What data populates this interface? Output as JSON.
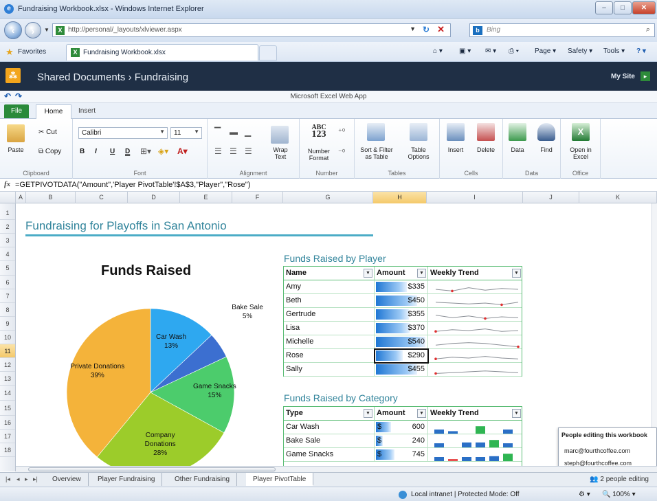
{
  "window": {
    "title": "Fundraising Workbook.xlsx - Windows Internet Explorer"
  },
  "browser": {
    "url": "http://personal/_layouts/xlviewer.aspx",
    "search_placeholder": "Bing",
    "favorites_label": "Favorites",
    "tab_title": "Fundraising Workbook.xlsx",
    "commands": [
      "Page ▾",
      "Safety ▾",
      "Tools ▾"
    ]
  },
  "sharepoint": {
    "breadcrumb": "Shared Documents › Fundraising",
    "my_site": "My Site"
  },
  "excel": {
    "app_title": "Microsoft Excel Web App",
    "tabs": {
      "file": "File",
      "home": "Home",
      "insert": "Insert"
    },
    "ribbon": {
      "clipboard": {
        "label": "Clipboard",
        "paste": "Paste",
        "cut": "Cut",
        "copy": "Copy"
      },
      "font": {
        "label": "Font",
        "name": "Calibri",
        "size": "11",
        "bold": "B",
        "italic": "I",
        "underline": "U",
        "dunder": "D"
      },
      "alignment": {
        "label": "Alignment",
        "wrap": "Wrap Text"
      },
      "number": {
        "label": "Number",
        "format": "Number Format",
        "abc": "ABC",
        "n123": "123"
      },
      "tables": {
        "label": "Tables",
        "sort": "Sort & Filter as Table",
        "options": "Table Options"
      },
      "cells": {
        "label": "Cells",
        "insert": "Insert",
        "delete": "Delete"
      },
      "data": {
        "label": "Data",
        "data": "Data",
        "find": "Find"
      },
      "office": {
        "label": "Office",
        "open": "Open in Excel"
      }
    },
    "formula": "=GETPIVOTDATA(\"Amount\",'Player PivotTable'!$A$3,\"Player\",\"Rose\")",
    "columns": [
      "A",
      "B",
      "C",
      "D",
      "E",
      "F",
      "G",
      "H",
      "I",
      "J",
      "K"
    ],
    "selected_column": "H",
    "rows": [
      "1",
      "2",
      "3",
      "4",
      "5",
      "6",
      "7",
      "8",
      "9",
      "10",
      "11",
      "12",
      "13",
      "14",
      "15",
      "16",
      "17",
      "18"
    ],
    "selected_row": "11"
  },
  "sheet": {
    "heading": "Fundraising for Playoffs in San Antonio",
    "player_table": {
      "title": "Funds Raised by Player",
      "headers": [
        "Name",
        "Amount",
        "Weekly Trend"
      ],
      "rows": [
        {
          "name": "Amy",
          "amount": "$335",
          "pct": 0.62
        },
        {
          "name": "Beth",
          "amount": "$450",
          "pct": 0.83
        },
        {
          "name": "Gertrude",
          "amount": "$355",
          "pct": 0.66
        },
        {
          "name": "Lisa",
          "amount": "$370",
          "pct": 0.68
        },
        {
          "name": "Michelle",
          "amount": "$540",
          "pct": 1.0
        },
        {
          "name": "Rose",
          "amount": "$290",
          "pct": 0.54
        },
        {
          "name": "Sally",
          "amount": "$455",
          "pct": 0.84
        }
      ]
    },
    "category_table": {
      "title": "Funds Raised by Category",
      "headers": [
        "Type",
        "Amount",
        "Weekly Trend"
      ],
      "rows": [
        {
          "type": "Car Wash",
          "dollar": "$",
          "amount": "600",
          "pct": 0.22
        },
        {
          "type": "Bake Sale",
          "dollar": "$",
          "amount": "240",
          "pct": 0.09
        },
        {
          "type": "Game Snacks",
          "dollar": "$",
          "amount": "745",
          "pct": 0.27
        }
      ]
    }
  },
  "chart_data": {
    "type": "pie",
    "title": "Funds Raised",
    "slices": [
      {
        "label": "Car Wash",
        "value": 13,
        "value_label": "13%",
        "color": "#2ea8f0"
      },
      {
        "label": "Bake Sale",
        "value": 5,
        "value_label": "5%",
        "color": "#3c6fd0"
      },
      {
        "label": "Game Snacks",
        "value": 15,
        "value_label": "15%",
        "color": "#4ccc6c"
      },
      {
        "label": "Company Donations",
        "value": 28,
        "value_label": "28%",
        "color": "#9ccc2a"
      },
      {
        "label": "Private Donations",
        "value": 39,
        "value_label": "39%",
        "color": "#f4b33a"
      }
    ]
  },
  "people": {
    "header": "People editing this workbook",
    "emails": [
      "marc@fourthcoffee.com",
      "steph@fourthcoffee.com"
    ],
    "count": "2 people editing"
  },
  "sheet_tabs": [
    "Overview",
    "Player Fundraising",
    "Other Fundraising",
    "Player PivotTable"
  ],
  "status": {
    "zone": "Local intranet | Protected Mode: Off",
    "zoom": "100%"
  }
}
